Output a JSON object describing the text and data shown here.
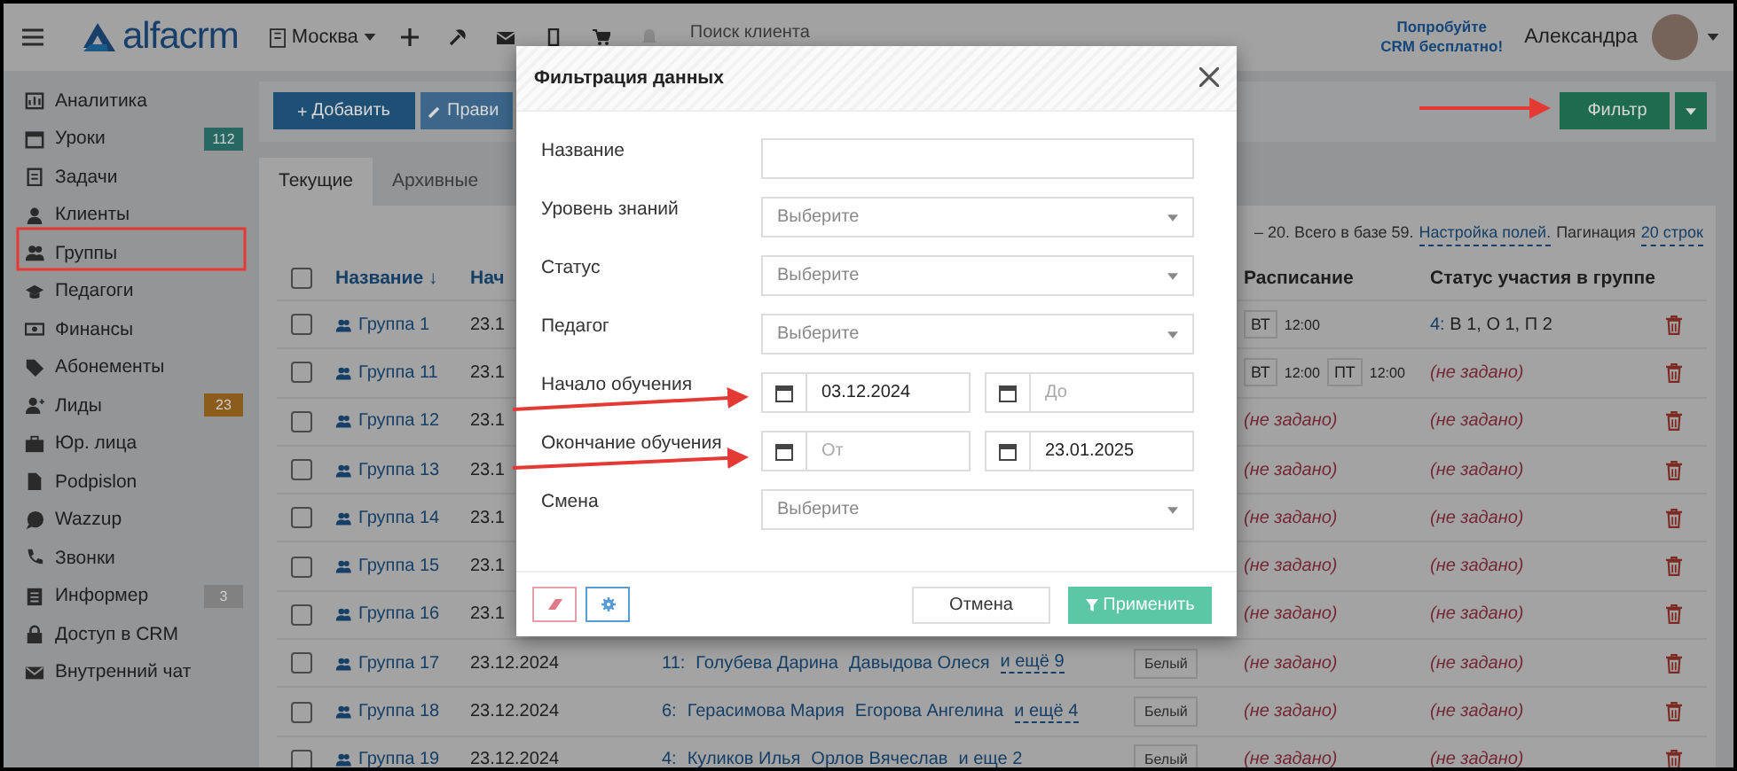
{
  "header": {
    "logo": "alfacrm",
    "branch": "Москва",
    "search": {
      "placeholder": "Поиск клиента"
    },
    "promo": [
      "Попробуйте",
      "CRM бесплатно!"
    ],
    "user": "Александра"
  },
  "sidebar": {
    "items": [
      {
        "label": "Аналитика"
      },
      {
        "label": "Уроки",
        "badge": {
          "text": "112",
          "color": "#286863"
        }
      },
      {
        "label": "Задачи"
      },
      {
        "label": "Клиенты"
      },
      {
        "label": "Группы"
      },
      {
        "label": "Педагоги"
      },
      {
        "label": "Финансы"
      },
      {
        "label": "Абонементы"
      },
      {
        "label": "Лиды",
        "badge": {
          "text": "23",
          "color": "#8b5c1b"
        }
      },
      {
        "label": "Юр. лица"
      },
      {
        "label": "Podpislon"
      },
      {
        "label": "Wazzup"
      },
      {
        "label": "Звонки"
      },
      {
        "label": "Информер",
        "badge": {
          "text": "3",
          "color": "#818181"
        }
      },
      {
        "label": "Доступ в CRM"
      },
      {
        "label": "Внутренний чат"
      }
    ]
  },
  "toolbar": {
    "buttons": [
      {
        "kind": "add",
        "label": "Добавить"
      },
      {
        "kind": "edit",
        "label": "Прави"
      }
    ],
    "filter_button": "Фильтр"
  },
  "tabs": [
    {
      "label": "Текущие",
      "selected": true
    },
    {
      "label": "Архивные",
      "selected": false
    }
  ],
  "summary": {
    "text": "– 20. Всего в базе 59.",
    "fields_link": "Настройка полей.",
    "pagination_label": "Пагинация",
    "pagination_link": "20 строк"
  },
  "table": {
    "select_all_checked": false,
    "columns": {
      "name": "Название ↓",
      "date": "Нач",
      "schedule": "Расписание",
      "status": "Статус участия в группе"
    },
    "rows": [
      {
        "checked": false,
        "name": "Группа 1",
        "date": "23.1",
        "schedule": [
          {
            "day": "ВТ",
            "time": "12:00"
          }
        ],
        "status": {
          "count": "4:",
          "text": "В 1, О 1, П 2"
        }
      },
      {
        "checked": false,
        "name": "Группа 11",
        "date": "23.1",
        "schedule": [
          {
            "day": "ВТ",
            "time": "12:00"
          },
          {
            "day": "ПТ",
            "time": "12:00"
          }
        ],
        "status_note": "(не задано)"
      },
      {
        "checked": false,
        "name": "Группа 12",
        "date": "23.1",
        "schedule_note": "(не задано)",
        "status_note": "(не задано)"
      },
      {
        "checked": false,
        "name": "Группа 13",
        "date": "23.1",
        "schedule_note": "(не задано)",
        "status_note": "(не задано)"
      },
      {
        "checked": false,
        "name": "Группа 14",
        "date": "23.1",
        "schedule_note": "(не задано)",
        "status_note": "(не задано)"
      },
      {
        "checked": false,
        "name": "Группа 15",
        "date": "23.1",
        "schedule_note": "(не задано)",
        "status_note": "(не задано)"
      },
      {
        "checked": false,
        "name": "Группа 16",
        "date": "23.1",
        "schedule_note": "(не задано)",
        "status_note": "(не задано)"
      },
      {
        "checked": false,
        "name": "Группа 17",
        "date": "23.12.2024",
        "members": {
          "count": "11:",
          "names": [
            "Голубева Дарина",
            "Давыдова Олеся"
          ],
          "more": "и ещё 9"
        },
        "color_label": "Белый",
        "schedule_note": "(не задано)",
        "status_note": "(не задано)"
      },
      {
        "checked": false,
        "name": "Группа 18",
        "date": "23.12.2024",
        "members": {
          "count": "6:",
          "names": [
            "Герасимова Мария",
            "Егорова Ангелина"
          ],
          "more": "и ещё 4"
        },
        "color_label": "Белый",
        "schedule_note": "(не задано)",
        "status_note": "(не задано)"
      },
      {
        "checked": false,
        "name": "Группа 19",
        "date": "23.12.2024",
        "members": {
          "count": "4:",
          "names": [
            "Куликов Илья",
            "Орлов Вячеслав"
          ],
          "more": "и еще 2"
        },
        "color_label": "Белый",
        "schedule_note": "(не задано)",
        "status_note": "(не задано)"
      }
    ]
  },
  "filter_dialog": {
    "title": "Фильтрация данных",
    "fields": [
      {
        "kind": "text",
        "label": "Название"
      },
      {
        "kind": "select",
        "label": "Уровень знаний",
        "placeholder": "Выберите"
      },
      {
        "kind": "select",
        "label": "Статус",
        "placeholder": "Выберите"
      },
      {
        "kind": "select",
        "label": "Педагог",
        "placeholder": "Выберите"
      },
      {
        "kind": "daterange",
        "label": "Начало обучения",
        "from": {
          "value": "03.12.2024"
        },
        "to": {
          "placeholder": "До"
        }
      },
      {
        "kind": "daterange",
        "label": "Окончание обучения",
        "from": {
          "placeholder": "От"
        },
        "to": {
          "value": "23.01.2025"
        }
      },
      {
        "kind": "select",
        "label": "Смена",
        "placeholder": "Выберите"
      }
    ],
    "cancel": "Отмена",
    "apply": "Применить"
  }
}
